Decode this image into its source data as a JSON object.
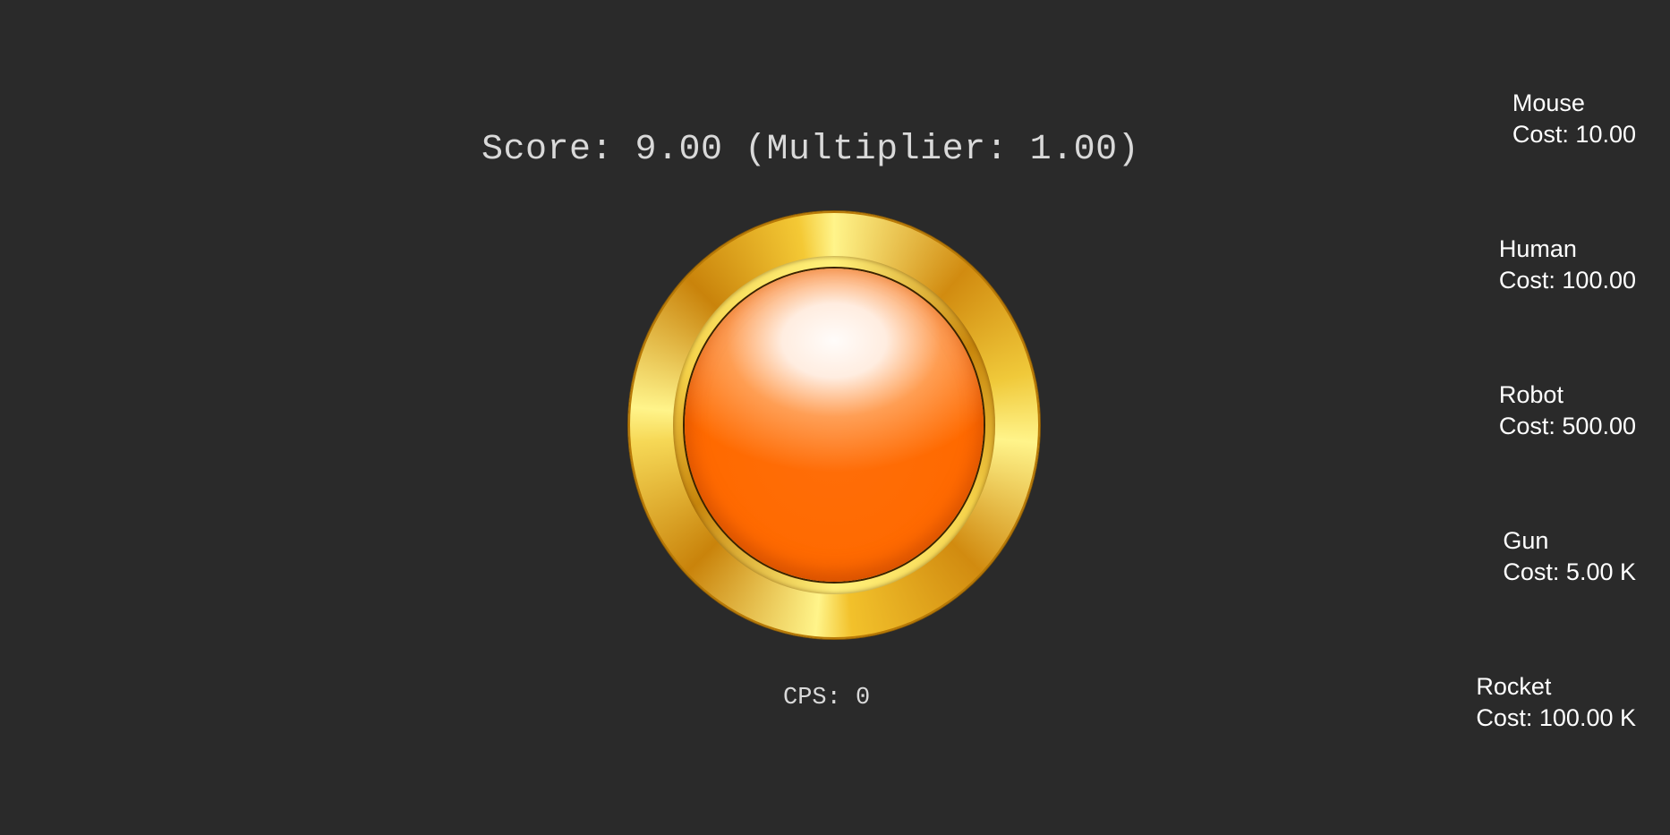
{
  "score": {
    "text": "Score: 9.00 (Multiplier: 1.00)"
  },
  "cps": {
    "text": "CPS: 0"
  },
  "colors": {
    "background": "#2a2a2a",
    "score_text": "#d9d9d9",
    "button_orange": "#ff6a00",
    "ring_gold": "#f5c631",
    "shop_text": "#ffffff"
  },
  "shop": {
    "items": [
      {
        "name": "Mouse",
        "cost": "Cost: 10.00"
      },
      {
        "name": "Human",
        "cost": "Cost: 100.00"
      },
      {
        "name": "Robot",
        "cost": "Cost: 500.00"
      },
      {
        "name": "Gun",
        "cost": "Cost: 5.00 K"
      },
      {
        "name": "Rocket",
        "cost": "Cost: 100.00 K"
      }
    ]
  },
  "icons": {
    "main_button": "orange-click-button-icon"
  }
}
